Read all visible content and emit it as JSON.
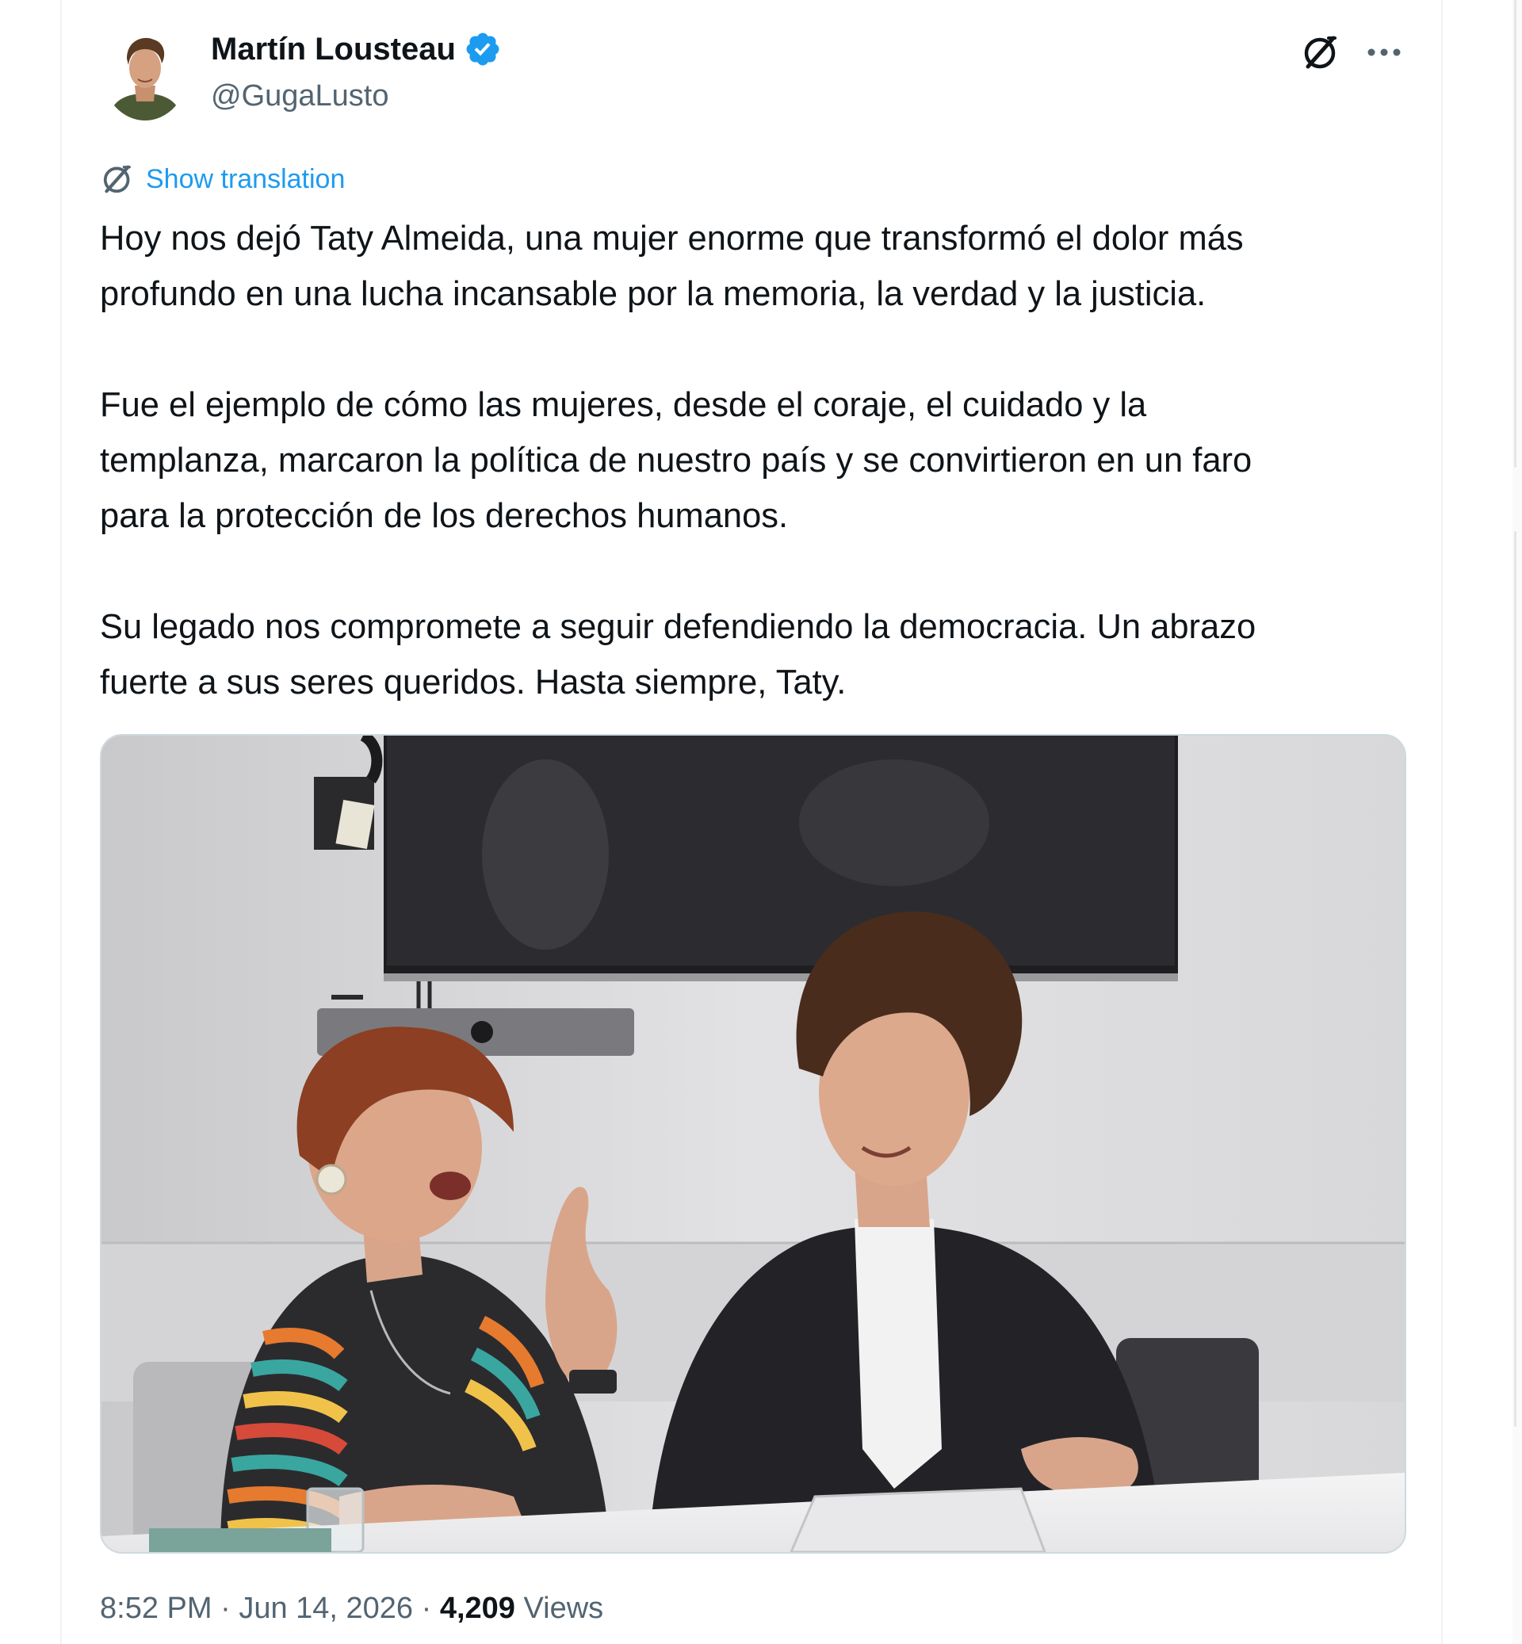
{
  "tweet": {
    "author": {
      "name": "Martín Lousteau",
      "handle": "@GugaLusto",
      "verified": true
    },
    "translate_label": "Show translation",
    "paragraphs": [
      {
        "lines": [
          "Hoy nos dejó Taty Almeida, una mujer enorme que transformó el dolor más",
          "profundo en una lucha incansable por la memoria, la verdad y la justicia."
        ]
      },
      {
        "lines": [
          "Fue el ejemplo de cómo las mujeres, desde el coraje, el cuidado y la",
          "templanza, marcaron la política de nuestro país y se convirtieron en un faro",
          "para la protección de los derechos humanos."
        ]
      },
      {
        "lines": [
          "Su legado nos compromete a seguir defendiendo la democracia. Un abrazo",
          "fuerte a sus seres queridos. Hasta siempre, Taty."
        ]
      }
    ],
    "footer": {
      "time": "8:52 PM",
      "separator": " · ",
      "date": "Jun 14, 2026",
      "views_count": "4,209",
      "views_label": "Views"
    }
  },
  "colors": {
    "accent": "#1d9bf0",
    "text_primary": "#0f1419",
    "text_secondary": "#536471",
    "border": "#cfd9de"
  },
  "icons": {
    "verified": "verified-badge-icon",
    "grok": "grok-icon",
    "more": "more-options-icon",
    "translate": "translate-icon"
  }
}
